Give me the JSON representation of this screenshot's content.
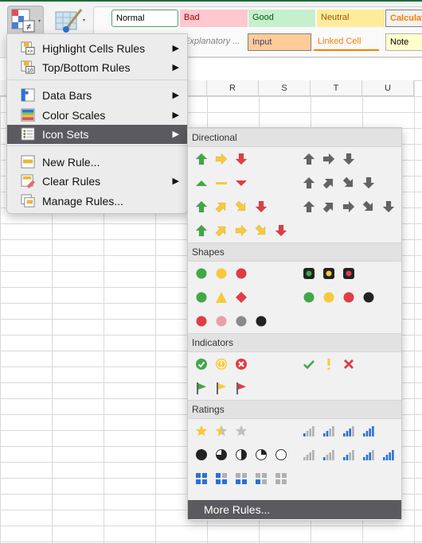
{
  "ribbon": {
    "conditional_formatting_icon": "conditional-formatting-icon",
    "format_as_table_icon": "format-table-icon",
    "styles": [
      {
        "label": "Normal",
        "bg": "#ffffff",
        "fg": "#000000",
        "border": "#5a9d6a"
      },
      {
        "label": "Bad",
        "bg": "#ffc7ce",
        "fg": "#9c0006"
      },
      {
        "label": "Good",
        "bg": "#c6efce",
        "fg": "#006100"
      },
      {
        "label": "Neutral",
        "bg": "#ffeb9c",
        "fg": "#9c5700"
      },
      {
        "label": "Calculation",
        "bg": "#f2f2f2",
        "fg": "#fa7d00",
        "border": "#7f7f7f"
      },
      {
        "label": "",
        "bg": "#a5a5a5",
        "fg": "#ffffff",
        "border": "#3f3f3f"
      },
      {
        "label": "Explanatory ...",
        "bg": "transparent",
        "fg": "#7f7f7f"
      },
      {
        "label": "Input",
        "bg": "#ffcc99",
        "fg": "#3f3f76",
        "border": "#7f7f7f"
      },
      {
        "label": "Linked Cell",
        "bg": "transparent",
        "fg": "#fa7d00"
      },
      {
        "label": "Note",
        "bg": "#ffffcc",
        "fg": "#000000",
        "border": "#b2b2b2"
      }
    ]
  },
  "columns": [
    "R",
    "S",
    "T",
    "U"
  ],
  "menu": {
    "items": [
      {
        "label": "Highlight Cells Rules",
        "submenu": true
      },
      {
        "label": "Top/Bottom Rules",
        "submenu": true
      },
      {
        "label": "Data Bars",
        "submenu": true
      },
      {
        "label": "Color Scales",
        "submenu": true
      },
      {
        "label": "Icon Sets",
        "submenu": true,
        "selected": true
      },
      {
        "label": "New Rule...",
        "submenu": false
      },
      {
        "label": "Clear Rules",
        "submenu": true
      },
      {
        "label": "Manage Rules...",
        "submenu": false
      }
    ],
    "submenu_arrow": "▶"
  },
  "icon_sets": {
    "sections": [
      {
        "title": "Directional",
        "rows": [
          [
            [
              "au:g",
              "ar:y",
              "ad:r"
            ],
            [
              "au:k",
              "ar:k",
              "ad:k"
            ]
          ],
          [
            [
              "tu:g",
              "dash:y",
              "td:r"
            ],
            [
              "au:k",
              "aur:k",
              "adr:k",
              "ad:k"
            ]
          ],
          [
            [
              "au:g",
              "aur:y",
              "adr:y",
              "ad:r"
            ],
            [
              "au:k",
              "aur:k",
              "ar:k",
              "adr:k",
              "ad:k"
            ]
          ],
          [
            [
              "au:g",
              "aur:y",
              "ar:y",
              "adr:y",
              "ad:r"
            ],
            []
          ]
        ]
      },
      {
        "title": "Shapes",
        "rows": [
          [
            [
              "c:g",
              "c:y",
              "c:r"
            ],
            [
              "tl:g",
              "tl:y",
              "tl:r"
            ]
          ],
          [
            [
              "c:g",
              "tri:y",
              "dia:r"
            ],
            [
              "c:g",
              "c:y",
              "c:r",
              "c:b"
            ]
          ],
          [
            [
              "c:r",
              "c:p",
              "c:m",
              "c:b"
            ],
            []
          ]
        ]
      },
      {
        "title": "Indicators",
        "rows": [
          [
            [
              "cchk:g",
              "cexc:y",
              "cx:r"
            ],
            [
              "chk:g",
              "exc:y",
              "x:r"
            ]
          ],
          [
            [
              "flag:g",
              "flag:y",
              "flag:r"
            ],
            []
          ]
        ]
      },
      {
        "title": "Ratings",
        "rows": [
          [
            [
              "star:2",
              "star:1",
              "star:0"
            ],
            [
              "bars4:1",
              "bars4:2",
              "bars4:3",
              "bars4:4"
            ]
          ],
          [
            [
              "pie:4",
              "pie:3",
              "pie:2",
              "pie:1",
              "pie:0"
            ],
            [
              "bars4:0",
              "bars4:1",
              "bars4:2",
              "bars4:3",
              "bars4:4"
            ]
          ],
          [
            [
              "box:4",
              "box:3",
              "box:2",
              "box:1",
              "box:0"
            ],
            []
          ]
        ]
      }
    ],
    "more_rules": "More Rules...",
    "colors": {
      "g": "#42a746",
      "y": "#f8c93a",
      "r": "#df3d45",
      "k": "#636363",
      "b": "#222222",
      "p": "#e8a0a4",
      "m": "#8a8a8a",
      "blue": "#2a72d6",
      "gray": "#b0b0b0"
    }
  }
}
